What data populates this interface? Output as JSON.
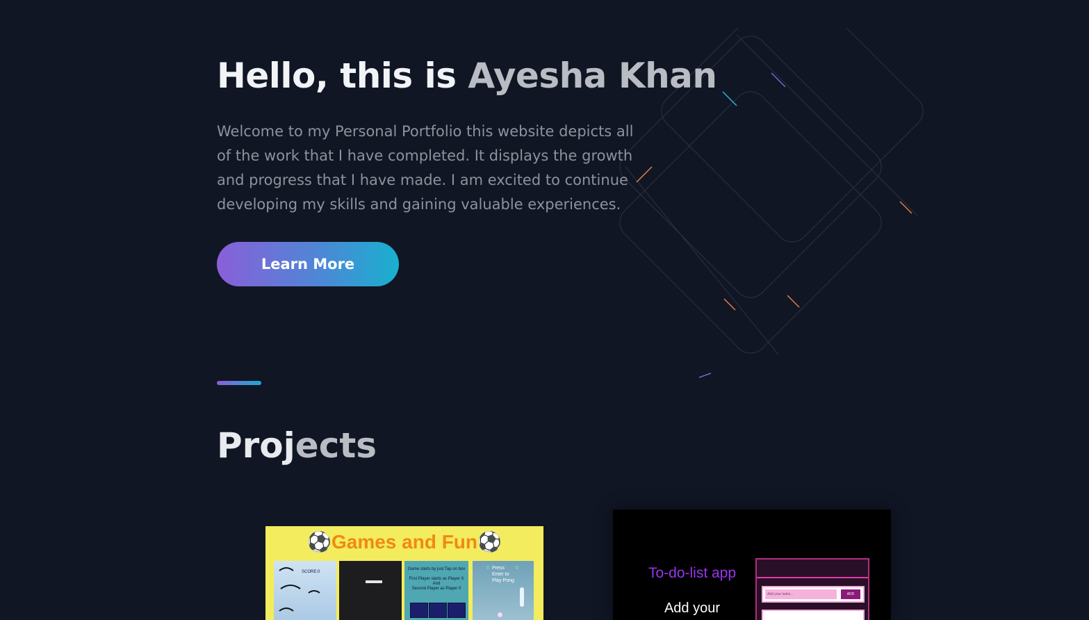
{
  "hero": {
    "greeting": "Hello, this is ",
    "name": "Ayesha Khan",
    "description": "Welcome to my Personal Portfolio this website depicts all of the work that I have completed. It displays the growth and progress that I have made. I am excited to continue developing my skills and gaining valuable experiences.",
    "cta_label": "Learn More"
  },
  "projects": {
    "heading_start": "Proj",
    "heading_end": "ects",
    "cards": [
      {
        "title": "⚽Games and Fun⚽",
        "panels": {
          "score_label": "SCORE:0",
          "tictactoe_line1": "Game starts by just Tap on box",
          "tictactoe_line2": "First Player starts as Player X",
          "tictactoe_line3": "And",
          "tictactoe_line4": "Second Player as Player 0",
          "pong_score_left": "0",
          "pong_score_right": "0",
          "pong_text": "Press Enter to Play Pong"
        }
      },
      {
        "title": "To-do-list app",
        "subtitle": "Add your",
        "input_placeholder": "Add your tasks...",
        "add_label": "ADD"
      }
    ]
  },
  "colors": {
    "background": "#101624",
    "accent_start": "#8a5fd9",
    "accent_end": "#18b0cf"
  }
}
